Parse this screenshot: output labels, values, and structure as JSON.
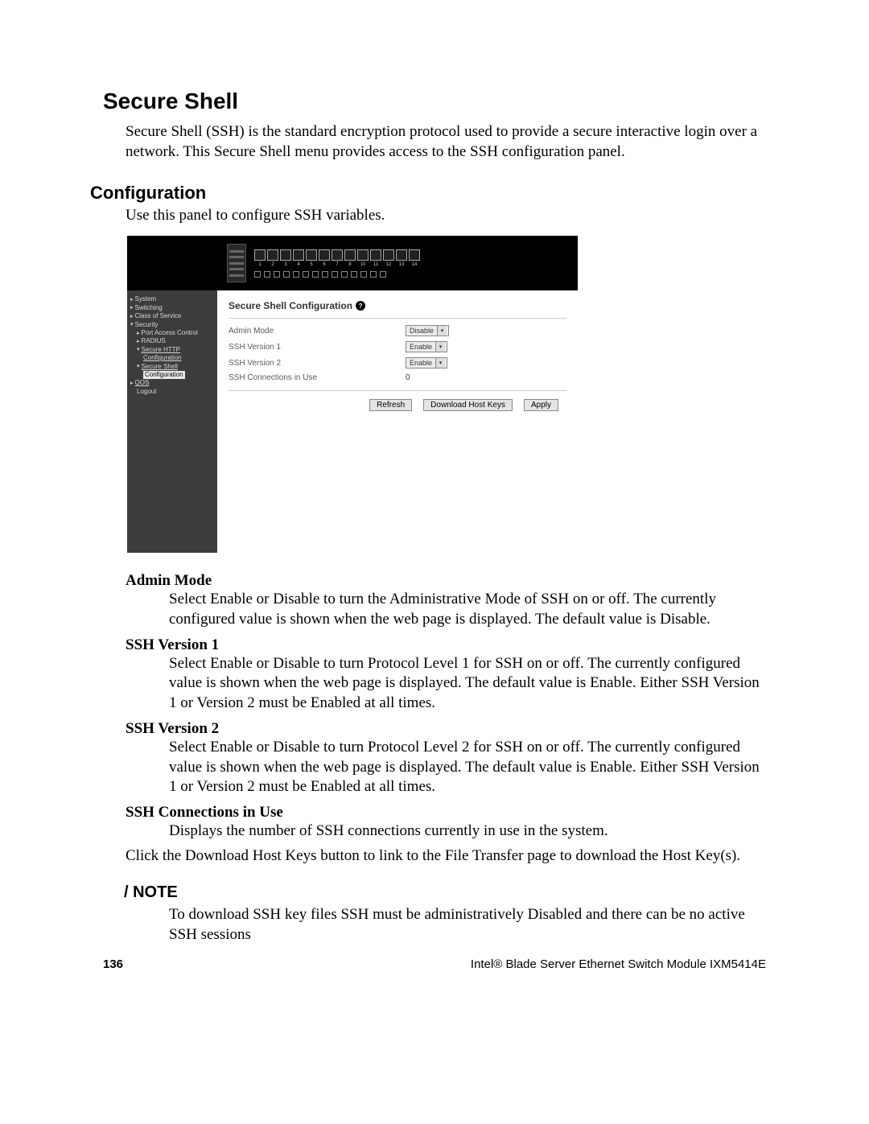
{
  "h1": "Secure Shell",
  "intro": "Secure Shell (SSH) is the standard encryption protocol used to provide a secure interactive login over a network. This Secure Shell menu provides access to the SSH configuration panel.",
  "h2": "Configuration",
  "configIntro": "Use this panel to configure SSH variables.",
  "portNumbers": [
    "1",
    "2",
    "3",
    "4",
    "5",
    "6",
    "7",
    "8",
    "10",
    "11",
    "12",
    "13",
    "14"
  ],
  "nav": {
    "system": "System",
    "switching": "Switching",
    "classOfService": "Class of Service",
    "security": "Security",
    "portAccessControl": "Port Access Control",
    "radius": "RADIUS",
    "secureHttp": "Secure HTTP",
    "secureHttpConfig": "Configuration",
    "secureShell": "Secure Shell",
    "secureShellConfig": "Configuration",
    "qos": "QOS",
    "logout": "Logout"
  },
  "panel": {
    "title": "Secure Shell Configuration",
    "rows": {
      "adminMode": {
        "label": "Admin Mode",
        "value": "Disable"
      },
      "sshV1": {
        "label": "SSH Version 1",
        "value": "Enable"
      },
      "sshV2": {
        "label": "SSH Version 2",
        "value": "Enable"
      },
      "conn": {
        "label": "SSH Connections in Use",
        "value": "0"
      }
    },
    "buttons": {
      "refresh": "Refresh",
      "download": "Download Host Keys",
      "apply": "Apply"
    }
  },
  "defs": {
    "adminMode": {
      "term": "Admin Mode",
      "desc": "Select Enable or Disable to turn the Administrative Mode of SSH on or off. The currently configured value is shown when the web page is displayed. The default value is Disable."
    },
    "v1": {
      "term": "SSH Version 1",
      "desc": "Select Enable or Disable to turn Protocol Level 1 for SSH on or off. The currently configured value is shown when the web page is displayed. The default value is Enable. Either SSH Version 1 or Version 2 must be Enabled at all times."
    },
    "v2": {
      "term": "SSH Version 2",
      "desc": "Select Enable or Disable to turn Protocol Level 2 for SSH on or off. The currently configured value is shown when the web page is displayed. The default value is Enable. Either SSH Version 1 or Version 2 must be Enabled at all times."
    },
    "conn": {
      "term": "SSH Connections in Use",
      "desc": "Displays the number of SSH connections currently in use in the system."
    }
  },
  "clickLine": "Click the Download Host Keys button to link to the File Transfer page to download the Host Key(s).",
  "note": {
    "hdr": "/ NOTE",
    "body": "To download SSH key files SSH must be administratively Disabled and there can be no active SSH sessions"
  },
  "footer": {
    "page": "136",
    "doc": "Intel® Blade Server Ethernet Switch Module IXM5414E"
  }
}
